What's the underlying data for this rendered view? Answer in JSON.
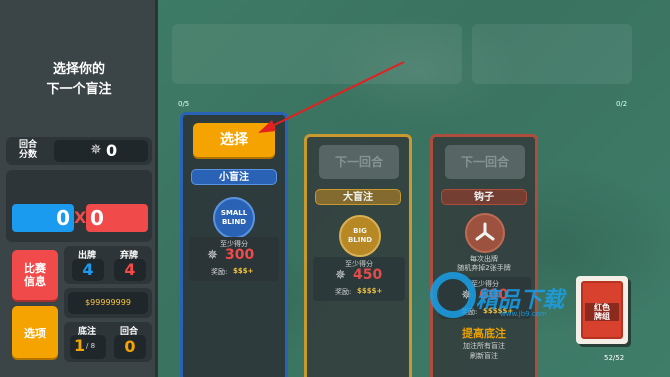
{
  "sidebar": {
    "title_line1": "选择你的",
    "title_line2": "下一个盲注",
    "round_score_label_1": "回合",
    "round_score_label_2": "分数",
    "round_score_value": "0",
    "chips_value": "0",
    "mult_value": "0",
    "multiply_symbol": "X",
    "run_info_label_1": "比赛",
    "run_info_label_2": "信息",
    "options_label": "选项",
    "hands_label": "出牌",
    "hands_value": "4",
    "discards_label": "弃牌",
    "discards_value": "4",
    "money_value": "$99999999",
    "ante_label": "底注",
    "ante_value": "1",
    "ante_max": "/ 8",
    "round_label": "回合",
    "round_value": "0"
  },
  "counters": {
    "left": "0/5",
    "right": "0/2"
  },
  "blinds": [
    {
      "button": "选择",
      "name": "小盲注",
      "chip_text_1": "SMALL",
      "chip_text_2": "BLIND",
      "score_label": "至少得分",
      "score": "300",
      "reward_label": "奖励:",
      "reward": "$$$+"
    },
    {
      "button": "下一回合",
      "name": "大盲注",
      "chip_text_1": "BIG",
      "chip_text_2": "BLIND",
      "score_label": "至少得分",
      "score": "450",
      "reward_label": "奖励:",
      "reward": "$$$$+"
    },
    {
      "button": "下一回合",
      "name": "钩子",
      "effect_1": "每次出牌",
      "effect_2": "随机弃掉2张手牌",
      "score_label": "至少得分",
      "score": "600",
      "reward_label": "奖励:",
      "reward": "$$$$$+",
      "raise_title": "提高底注",
      "raise_desc_1": "加注所有盲注",
      "raise_desc_2": "刷新盲注"
    }
  ],
  "deck": {
    "count": "52/52",
    "label_1": "红色",
    "label_2": "牌组"
  },
  "watermark": {
    "brand": "精品下载",
    "url": "www.jb9.com"
  },
  "colors": {
    "blue": "#1a9bf0",
    "red": "#f04a4a",
    "orange": "#f5a300",
    "small_blind": "#2a63b5",
    "big_blind": "#d39d2b",
    "boss": "#b84a3a"
  }
}
